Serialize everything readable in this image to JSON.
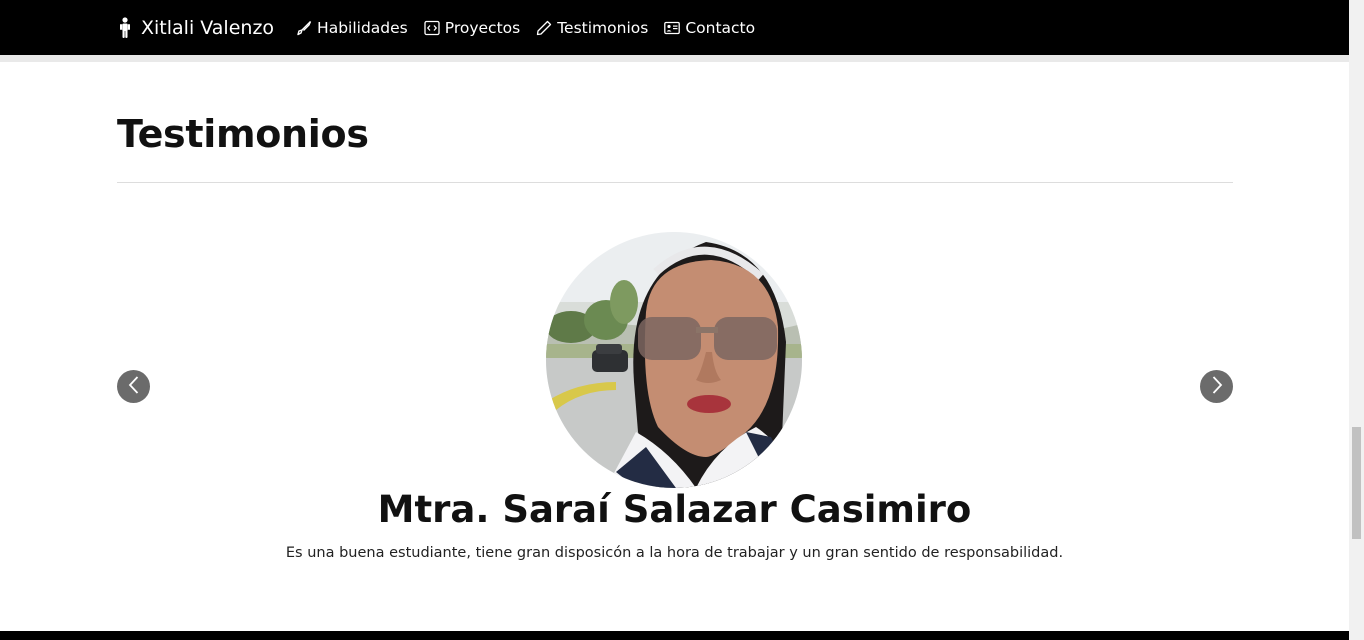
{
  "navbar": {
    "brand": "Xitlali Valenzo",
    "brand_icon": "person-standing-icon",
    "links": [
      {
        "label": "Habilidades",
        "icon": "brush-icon"
      },
      {
        "label": "Proyectos",
        "icon": "code-square-icon"
      },
      {
        "label": "Testimonios",
        "icon": "pencil-icon"
      },
      {
        "label": "Contacto",
        "icon": "person-card-icon"
      }
    ]
  },
  "section": {
    "title": "Testimonios"
  },
  "testimonial": {
    "name": "Mtra. Saraí Salazar Casimiro",
    "text": "Es una buena estudiante, tiene gran disposicón a la hora de trabajar y un gran sentido de responsabilidad.",
    "avatar": "testimonial-photo"
  },
  "carousel": {
    "prev_icon": "chevron-left-icon",
    "next_icon": "chevron-right-icon"
  },
  "colors": {
    "navbar_bg": "#000000",
    "carousel_button": "#6b6b6b",
    "divider": "#dddddd"
  }
}
